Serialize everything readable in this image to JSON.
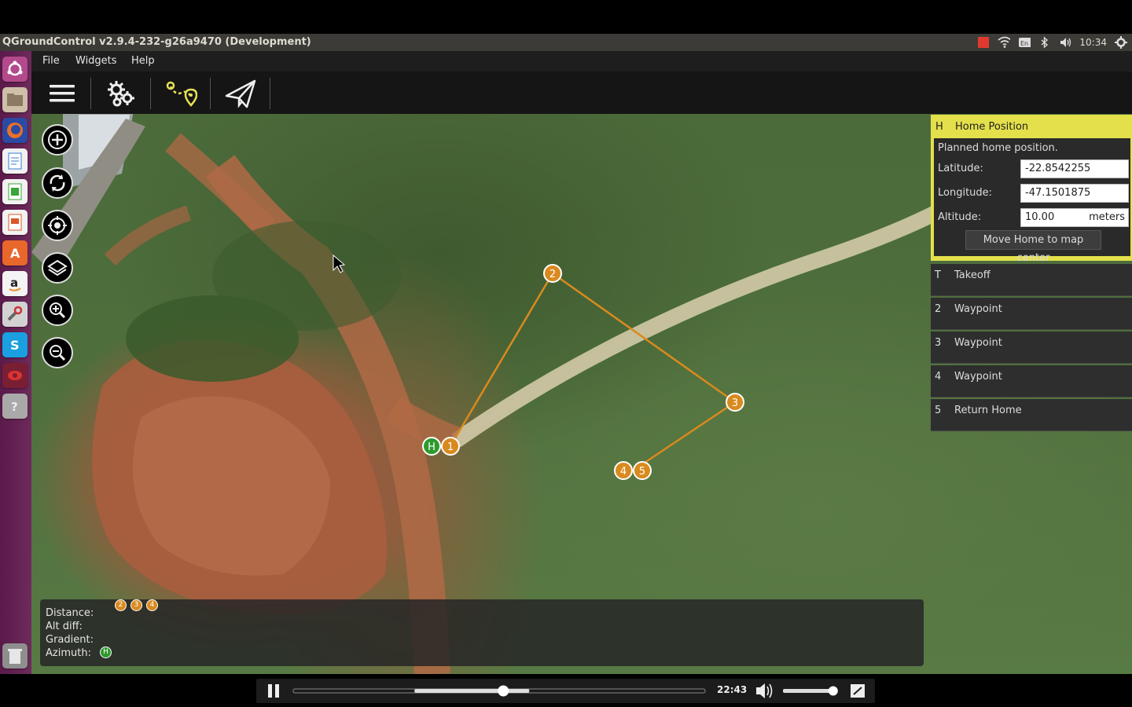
{
  "window": {
    "title": "QGroundControl v2.9.4-232-g26a9470 (Development)",
    "clock": "10:34"
  },
  "menu": {
    "file": "File",
    "widgets": "Widgets",
    "help": "Help"
  },
  "launcher": {
    "icons": [
      "ubuntu-dash-icon",
      "files-icon",
      "firefox-icon",
      "writer-icon",
      "calc-icon",
      "impress-icon",
      "software-center-icon",
      "amazon-icon",
      "system-settings-icon",
      "skype-icon",
      "qgroundcontrol-icon",
      "unknown-app-icon",
      "trash-icon"
    ]
  },
  "home_position": {
    "marker": "H",
    "title": "Home Position",
    "description": "Planned home position.",
    "latitude_label": "Latitude:",
    "latitude": "-22.8542255",
    "longitude_label": "Longitude:",
    "longitude": "-47.1501875",
    "altitude_label": "Altitude:",
    "altitude": "10.00",
    "altitude_unit": "meters",
    "center_button": "Move Home to map center"
  },
  "mission_items": [
    {
      "num": "T",
      "label": "Takeoff"
    },
    {
      "num": "2",
      "label": "Waypoint"
    },
    {
      "num": "3",
      "label": "Waypoint"
    },
    {
      "num": "4",
      "label": "Waypoint"
    },
    {
      "num": "5",
      "label": "Return Home"
    }
  ],
  "map_markers": {
    "home": "H",
    "w1": "1",
    "w2": "2",
    "w3": "3",
    "w4": "4",
    "w5": "5"
  },
  "status_panel": {
    "distance_label": "Distance:",
    "alt_diff_label": "Alt diff:",
    "gradient_label": "Gradient:",
    "azimuth_label": "Azimuth:",
    "mini_markers": [
      "2",
      "3",
      "4"
    ],
    "azimuth_marker": "H"
  },
  "player": {
    "time": "22:43",
    "progress": 0.51,
    "volume": 0.85
  },
  "colors": {
    "waypoint": "#d98a1e",
    "home": "#2e9a2e",
    "home_panel": "#e3e04b",
    "toolbar": "#151515"
  }
}
